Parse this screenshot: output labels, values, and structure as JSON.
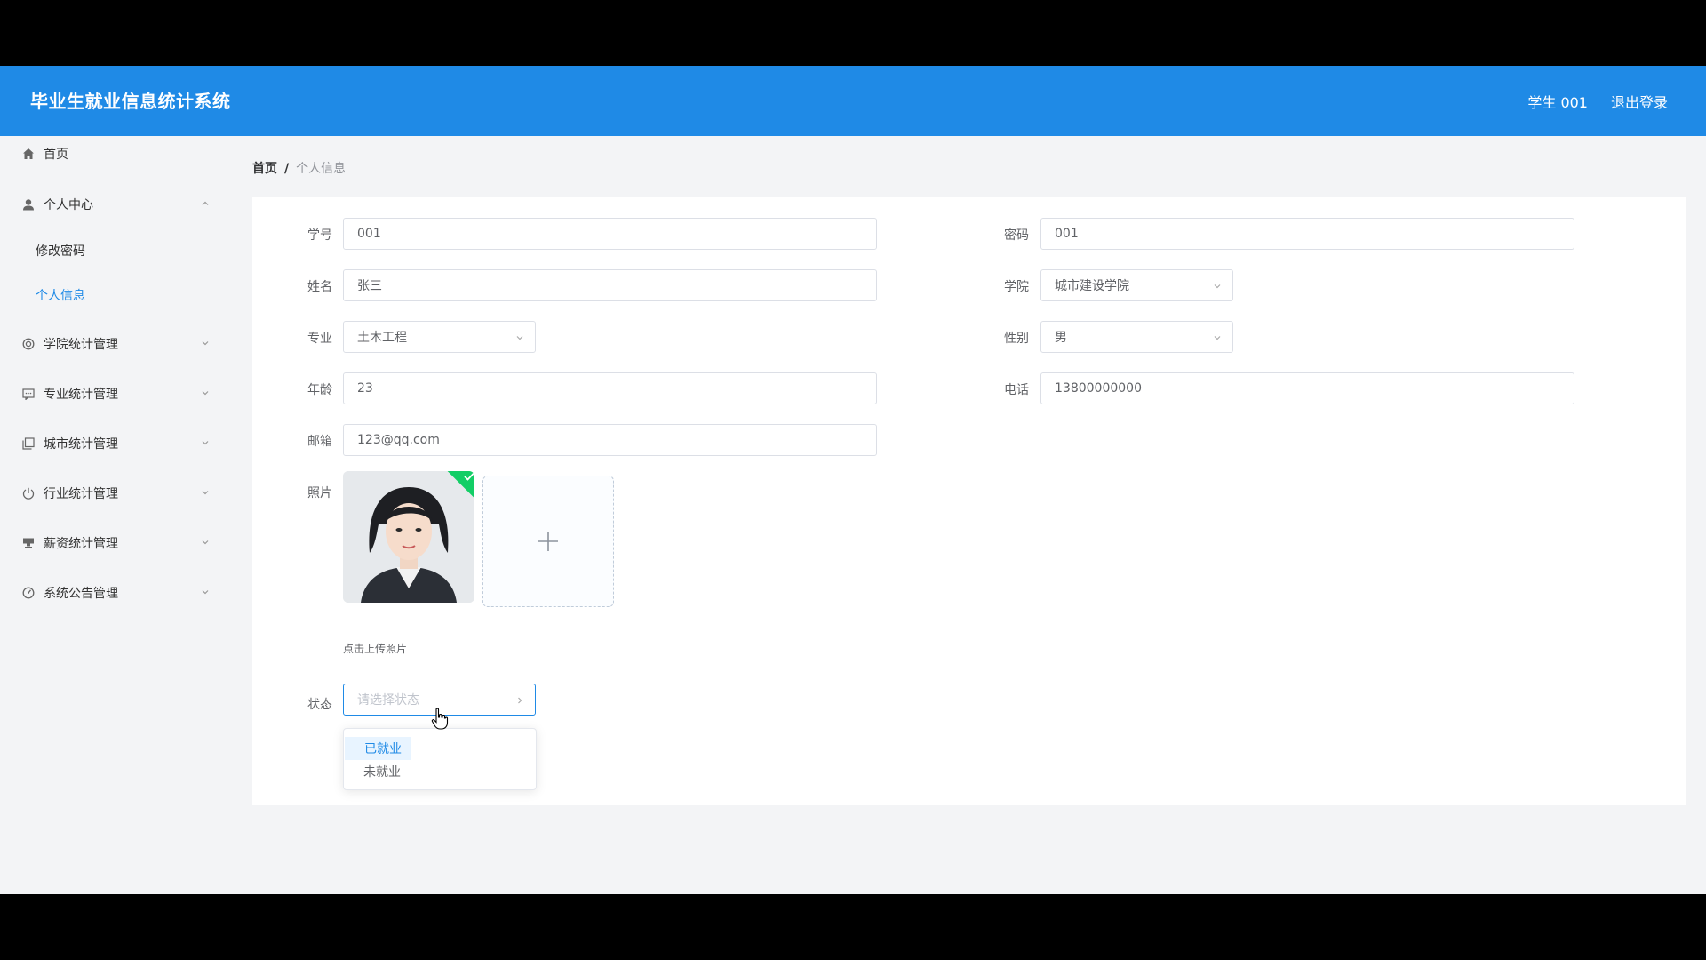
{
  "header": {
    "title": "毕业生就业信息统计系统",
    "user": "学生 001",
    "logout": "退出登录",
    "brand_color": "#1f8ae6"
  },
  "sidebar": {
    "items": [
      {
        "label": "首页",
        "icon": "home-icon"
      },
      {
        "label": "个人中心",
        "icon": "user-icon",
        "expanded": true,
        "children": [
          "修改密码",
          "个人信息"
        ]
      },
      {
        "label": "学院统计管理",
        "icon": "circle-icon"
      },
      {
        "label": "专业统计管理",
        "icon": "message-icon"
      },
      {
        "label": "城市统计管理",
        "icon": "copy-icon"
      },
      {
        "label": "行业统计管理",
        "icon": "power-icon"
      },
      {
        "label": "薪资统计管理",
        "icon": "stamp-icon"
      },
      {
        "label": "系统公告管理",
        "icon": "gauge-icon"
      }
    ],
    "active_child": "个人信息"
  },
  "breadcrumb": {
    "home": "首页",
    "sep": "/",
    "current": "个人信息"
  },
  "form": {
    "student_id": {
      "label": "学号",
      "value": "001"
    },
    "password": {
      "label": "密码",
      "value": "001"
    },
    "name": {
      "label": "姓名",
      "value": "张三"
    },
    "college": {
      "label": "学院",
      "value": "城市建设学院"
    },
    "major": {
      "label": "专业",
      "value": "土木工程"
    },
    "gender": {
      "label": "性别",
      "value": "男"
    },
    "age": {
      "label": "年龄",
      "value": "23"
    },
    "phone": {
      "label": "电话",
      "value": "13800000000"
    },
    "email": {
      "label": "邮箱",
      "value": "123@qq.com"
    },
    "photo": {
      "label": "照片",
      "tip": "点击上传照片"
    },
    "status": {
      "label": "状态",
      "placeholder": "请选择状态",
      "options": [
        "已就业",
        "未就业"
      ]
    }
  }
}
